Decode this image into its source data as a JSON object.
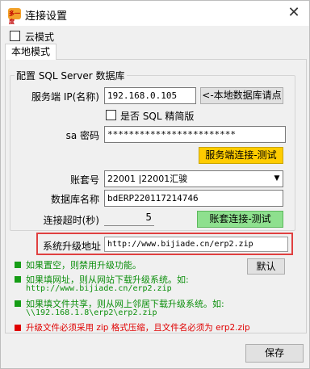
{
  "window": {
    "title": "连接设置",
    "app_icon_text": "多一度"
  },
  "cloud_mode": {
    "label": "云模式",
    "checked": false
  },
  "tab_local": "本地模式",
  "sql_group": {
    "title": "配置 SQL Server 数据库",
    "server_label": "服务端 IP(名称)",
    "server_value": "192.168.0.105",
    "local_db_button": "<-本地数据库请点",
    "sql_express_label": "是否 SQL 精简版",
    "sql_express_checked": false,
    "sa_label": "sa 密码",
    "sa_value": "************************",
    "test_server_button": "服务端连接-测试",
    "account_label": "账套号",
    "account_value": "22001 |22001汇骏",
    "dbname_label": "数据库名称",
    "dbname_value": "bdERP220117214746",
    "timeout_label": "连接超时(秒)",
    "timeout_value": "5",
    "test_account_button": "账套连接-测试"
  },
  "upgrade": {
    "label": "系统升级地址",
    "value": "http://www.bijiade.cn/erp2.zip",
    "default_button": "默认"
  },
  "notes": {
    "line1": "如果置空，则禁用升级功能。",
    "line2": "如果填网址，则从网站下载升级系统。如:",
    "line2_example": "http://www.bijiade.cn/erp2.zip",
    "line3": "如果填文件共享，则从网上邻居下载升级系统。如:",
    "line3_example": "\\\\192.168.1.8\\erp2\\erp2.zip",
    "line4": "升级文件必须采用 zip 格式压缩，且文件名必须为 erp2.zip"
  },
  "save_button": "保存",
  "colors": {
    "green_text": "#0c8f0c",
    "red_text": "#e00000",
    "highlight_border": "#e04040",
    "test_server_bg": "#ffcc00",
    "test_account_bg": "#8ee08e"
  }
}
